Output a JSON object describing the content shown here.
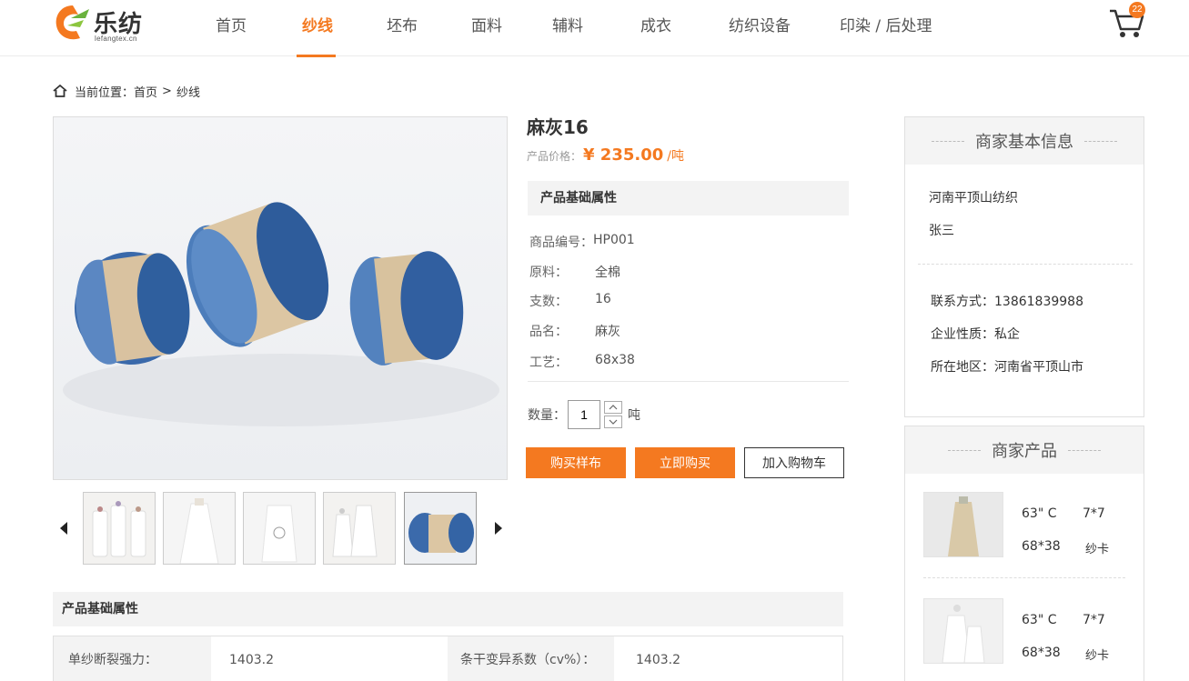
{
  "header": {
    "logo_name": "乐纺",
    "logo_domain": "lefangtex.cn",
    "nav": [
      {
        "label": "首页",
        "active": false
      },
      {
        "label": "纱线",
        "active": true
      },
      {
        "label": "坯布",
        "active": false
      },
      {
        "label": "面料",
        "active": false
      },
      {
        "label": "辅料",
        "active": false
      },
      {
        "label": "成衣",
        "active": false
      },
      {
        "label": "纺织设备",
        "active": false
      },
      {
        "label": "印染 / 后处理",
        "active": false
      }
    ],
    "cart_count": "22",
    "accent_color": "#f47920"
  },
  "breadcrumb": {
    "prefix": "当前位置：",
    "home": "首页",
    "separator": ">",
    "current": "纱线"
  },
  "product": {
    "title": "麻灰16",
    "price_label": "产品价格：",
    "price": "¥ 235.00",
    "price_unit": "/吨",
    "attr_header": "产品基础属性",
    "attributes": [
      {
        "key": "商品编号：",
        "value": "HP001"
      },
      {
        "key": "原料：",
        "value": "全棉"
      },
      {
        "key": "支数：",
        "value": "16"
      },
      {
        "key": "品名：",
        "value": "麻灰"
      },
      {
        "key": "工艺：",
        "value": "68x38"
      }
    ],
    "qty_label": "数量：",
    "qty_value": "1",
    "qty_unit": "吨",
    "btn_sample": "购买样布",
    "btn_buy": "立即购买",
    "btn_cart": "加入购物车",
    "thumbnail_count": 5,
    "selected_thumbnail": 5
  },
  "specs": {
    "header": "产品基础属性",
    "rows": [
      {
        "k1": "单纱断裂强力：",
        "v1": "1403.2",
        "k2": "条干变异系数（cv%）：",
        "v2": "1403.2"
      }
    ]
  },
  "merchant": {
    "title": "商家基本信息",
    "company": "河南平顶山纺织",
    "person": "张三",
    "contact": "联系方式：13861839988",
    "nature": "企业性质：私企",
    "region": "所在地区：河南省平顶山市"
  },
  "merchant_products": {
    "title": "商家产品",
    "items": [
      {
        "a": "63\" C",
        "b": "7*7",
        "c": "68*38",
        "d": "纱卡"
      },
      {
        "a": "63\" C",
        "b": "7*7",
        "c": "68*38",
        "d": "纱卡"
      }
    ]
  }
}
